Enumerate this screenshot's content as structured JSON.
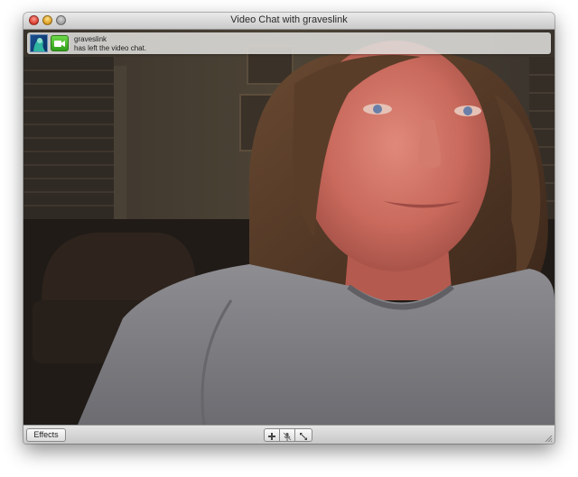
{
  "window": {
    "title": "Video Chat with graveslink"
  },
  "notification": {
    "username": "graveslink",
    "message": "has left the video chat."
  },
  "toolbar": {
    "effects_label": "Effects"
  },
  "icons": {
    "add": "plus-icon",
    "mute": "mute-microphone-icon",
    "fullscreen": "fullscreen-arrows-icon",
    "camera": "video-camera-icon"
  },
  "colors": {
    "camera_badge": "#3cb520",
    "avatar_bg": "#1b4f8f"
  }
}
